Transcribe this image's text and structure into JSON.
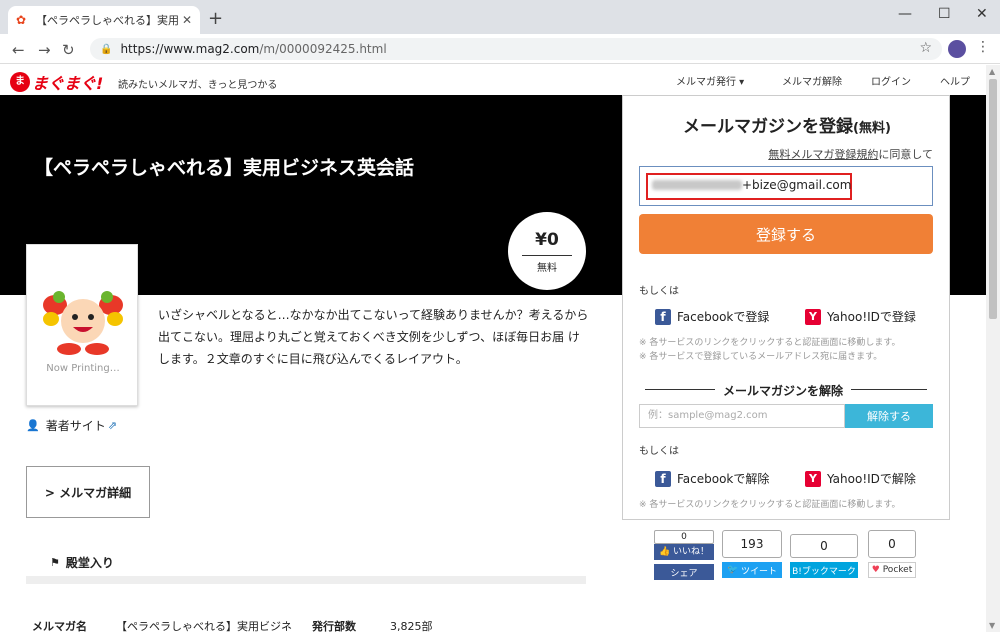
{
  "browser": {
    "tab_title": "【ペラペラしゃべれる】実用ビジネス英",
    "url_host": "https://www.mag2.com",
    "url_path": "/m/0000092425.html"
  },
  "site": {
    "logo_text": "まぐまぐ!",
    "tagline": "読みたいメルマガ、きっと見つかる",
    "nav": [
      "メルマガ発行 ▾",
      "メルマガ解除",
      "ログイン",
      "ヘルプ"
    ]
  },
  "magazine": {
    "title": "【ペラペラしゃべれる】実用ビジネス英会話",
    "price": "¥0",
    "price_label": "無料",
    "thumbnail_caption": "Now Printing…",
    "description": "いざシャベルとなると…なかなか出てこないって経験ありませんか？考えるから出てこない。理屈より丸ごと覚えておくべき文例を少しずつ、ほぼ毎日お届 けします。２文章のすぐに目に飛び込んでくるレイアウト。",
    "author_link": "著者サイト",
    "detail_button": "> メルマガ詳細",
    "hall_of_fame": "殿堂入り",
    "meta": {
      "name_label": "メルマガ名",
      "name_value": "【ペラペラしゃべれる】実用ビジネ",
      "circulation_label": "発行部数",
      "circulation_value": "3,825部"
    }
  },
  "panel": {
    "title": "メールマガジンを登録",
    "title_suffix": "(無料)",
    "agree_link": "無料メルマガ登録規約",
    "agree_text": "に同意して",
    "email_value": "+bize@gmail.com",
    "register_button": "登録する",
    "or_label": "もしくは",
    "facebook_register": "Facebookで登録",
    "yahoo_register": "Yahoo!IDで登録",
    "register_notes": [
      "※ 各サービスのリンクをクリックすると認証画面に移動します。",
      "※ 各サービスで登録しているメールアドレス宛に届きます。"
    ],
    "unsubscribe_heading": "メールマガジンを解除",
    "unsubscribe_placeholder": "例：sample@mag2.com",
    "unsubscribe_button": "解除する",
    "or_label_2": "もしくは",
    "facebook_unsubscribe": "Facebookで解除",
    "yahoo_unsubscribe": "Yahoo!IDで解除",
    "unsubscribe_note": "※ 各サービスのリンクをクリックすると認証画面に移動します。"
  },
  "share": {
    "facebook": {
      "count": "0",
      "like": "いいね！",
      "label": "シェア"
    },
    "twitter": {
      "count": "193",
      "label": "ツイート"
    },
    "hatena": {
      "count": "0",
      "label": "B!ブックマーク"
    },
    "pocket": {
      "count": "0",
      "label": "Pocket"
    }
  },
  "colors": {
    "brand_red": "#e60012",
    "register_orange": "#f08036",
    "unsubscribe_blue": "#3cb6d9",
    "facebook_blue": "#3b5998",
    "twitter_blue": "#1da1f2",
    "pocket_red": "#ef4056"
  }
}
